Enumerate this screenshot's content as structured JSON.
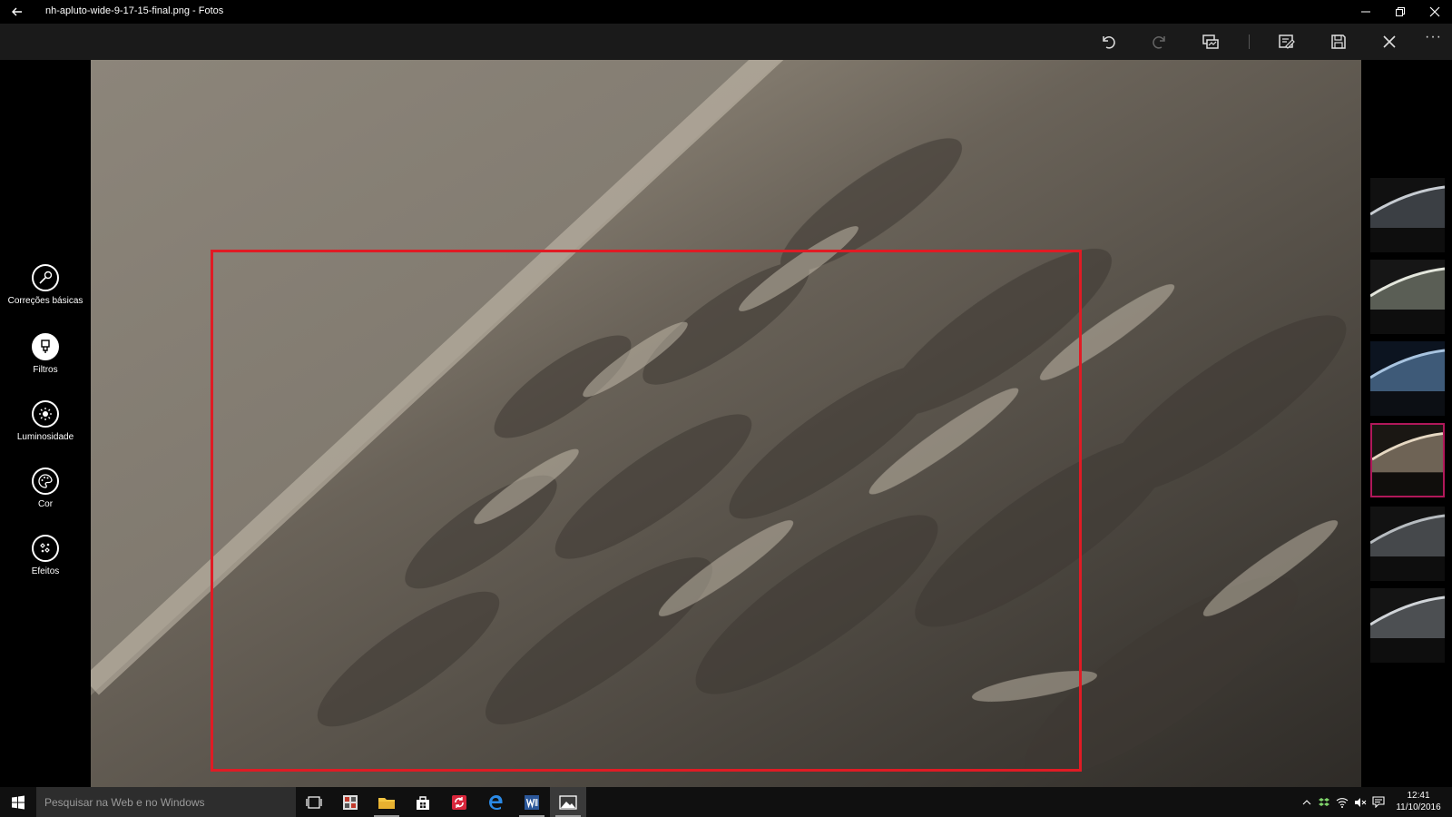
{
  "window": {
    "title": "nh-apluto-wide-9-17-15-final.png - Fotos",
    "controls": [
      "minimize-icon",
      "restore-icon",
      "close-icon"
    ]
  },
  "toolbar": {
    "buttons": [
      "undo-icon",
      "redo-icon",
      "compare-icon",
      "save-copy-icon",
      "save-icon",
      "cancel-icon"
    ],
    "more_label": "···"
  },
  "edit_tools": {
    "items": [
      {
        "label": "Correções básicas",
        "icon": "wrench-icon",
        "active": false
      },
      {
        "label": "Filtros",
        "icon": "brush-icon",
        "active": true
      },
      {
        "label": "Luminosidade",
        "icon": "sun-icon",
        "active": false
      },
      {
        "label": "Cor",
        "icon": "palette-icon",
        "active": false
      },
      {
        "label": "Efeitos",
        "icon": "effects-icon",
        "active": false
      }
    ]
  },
  "photo": {
    "selection_color": "#e01b24"
  },
  "zoom": {
    "buttons": [
      "fit-icon",
      "zoom-out-icon",
      "zoom-in-icon"
    ]
  },
  "filters": {
    "count": 6,
    "selected_index": 3,
    "selected_color": "#b0185a"
  },
  "taskbar": {
    "search_placeholder": "Pesquisar na Web e no Windows",
    "apps": [
      "task-view-icon",
      "app-icon",
      "file-explorer-icon",
      "store-icon",
      "sync-app-icon",
      "edge-icon",
      "word-icon",
      "photos-icon"
    ],
    "clock": {
      "time": "12:41",
      "date": "11/10/2016"
    }
  }
}
